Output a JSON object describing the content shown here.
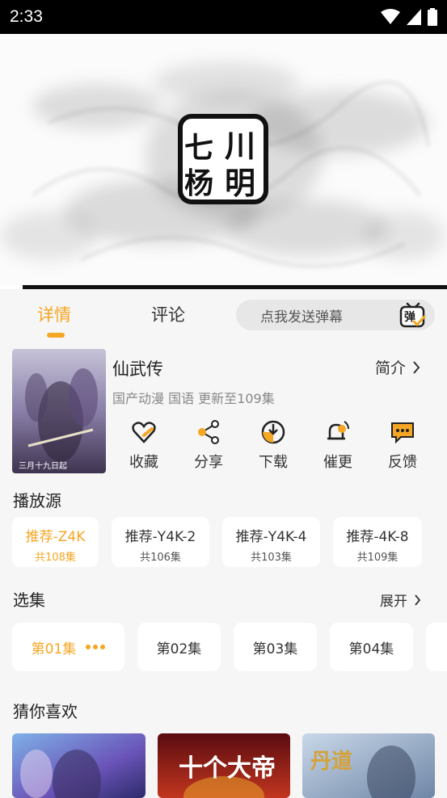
{
  "status": {
    "time": "2:33"
  },
  "player": {
    "logo_text": [
      "川",
      "明",
      "七",
      "杨"
    ],
    "progress": 0.05
  },
  "tabs": {
    "detail": "详情",
    "comment": "评论"
  },
  "danmaku": {
    "placeholder": "点我发送弹幕",
    "button_glyph": "弹"
  },
  "anime": {
    "title": "仙武传",
    "meta": "国产动漫 国语 更新至109集",
    "intro_label": "简介",
    "cover_text": "三月十九日起"
  },
  "actions": [
    {
      "label": "收藏",
      "icon": "heart-icon"
    },
    {
      "label": "分享",
      "icon": "share-icon"
    },
    {
      "label": "下载",
      "icon": "download-icon"
    },
    {
      "label": "催更",
      "icon": "bell-icon"
    },
    {
      "label": "反馈",
      "icon": "feedback-icon"
    }
  ],
  "sources": {
    "title": "播放源",
    "items": [
      {
        "name": "推荐-Z4K",
        "count": "共108集"
      },
      {
        "name": "推荐-Y4K-2",
        "count": "共106集"
      },
      {
        "name": "推荐-Y4K-4",
        "count": "共103集"
      },
      {
        "name": "推荐-4K-8",
        "count": "共109集"
      }
    ]
  },
  "episodes": {
    "title": "选集",
    "expand_label": "展开",
    "items": [
      "第01集",
      "第02集",
      "第03集",
      "第04集"
    ]
  },
  "recommend": {
    "title": "猜你喜欢",
    "items": [
      {
        "text": ""
      },
      {
        "text": "十个大帝"
      },
      {
        "text": "丹道"
      }
    ]
  },
  "colors": {
    "accent": "#f5a623",
    "status_bar": "#000000"
  }
}
